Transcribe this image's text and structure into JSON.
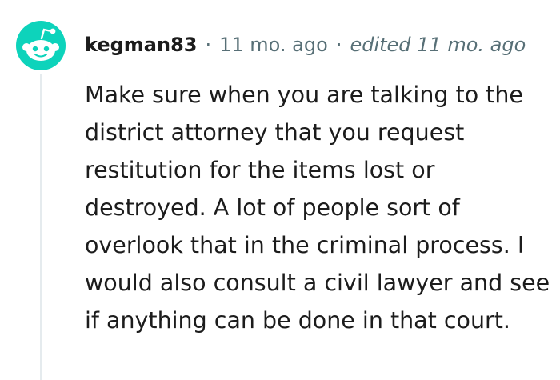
{
  "comment": {
    "author": "kegman83",
    "separator": "·",
    "time_ago": "11 mo. ago",
    "edited": "edited 11 mo. ago",
    "avatar_icon": "reddit-snoo-avatar-icon",
    "body": "Make sure when you are talking to the district attorney that you request restitution for the items lost or destroyed. A lot of people sort of overlook that in the criminal process. I would also consult a civil lawyer and see if anything can be done in that court."
  },
  "colors": {
    "avatar_bg": "#0dd3bb",
    "text": "#1c1c1c",
    "meta": "#576f76",
    "thread_line": "#e5ebee"
  }
}
